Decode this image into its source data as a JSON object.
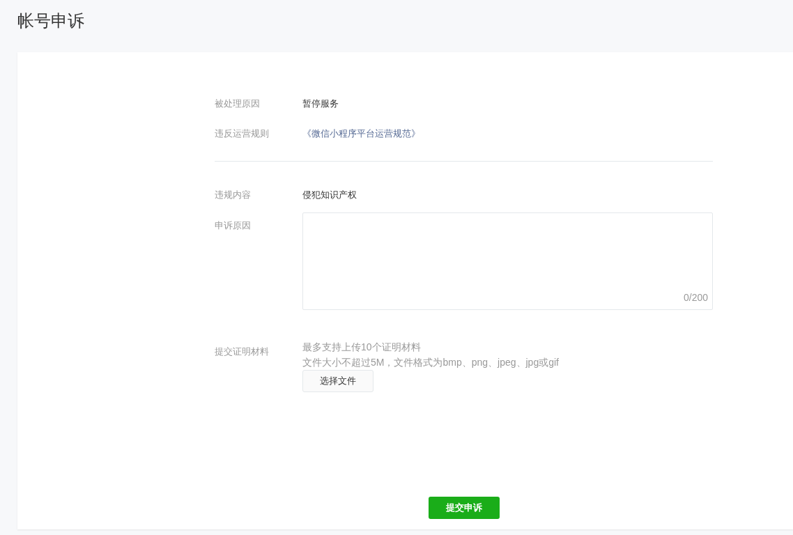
{
  "page_title": "帐号申诉",
  "info_rows": [
    {
      "label": "被处理原因",
      "value": "暂停服务",
      "kind": "text"
    },
    {
      "label": "违反运营规则",
      "value": "《微信小程序平台运营规范》",
      "kind": "link"
    }
  ],
  "violation": {
    "label": "违规内容",
    "value": "侵犯知识产权"
  },
  "appeal_reason": {
    "label": "申诉原因",
    "counter": "0/200"
  },
  "proof": {
    "label": "提交证明材料",
    "hints": [
      "最多支持上传10个证明材料",
      "文件大小不超过5M，文件格式为bmp、png、jpeg、jpg或gif"
    ],
    "button": "选择文件"
  },
  "submit": "提交申诉"
}
